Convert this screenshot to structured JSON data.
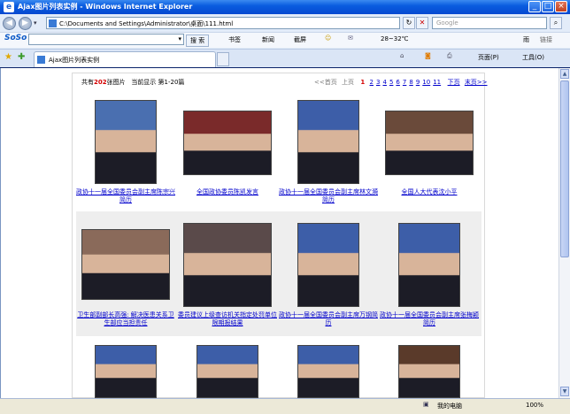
{
  "window": {
    "title": "Ajax图片列表实例 - Windows Internet Explorer",
    "icon": "ie-logo-icon"
  },
  "address": {
    "url": "C:\\Documents and Settings\\Administrator\\桌面\\111.html"
  },
  "search": {
    "placeholder": "Google"
  },
  "soso": {
    "logo": "SoSo",
    "search_button": "搜 索"
  },
  "toolbar": {
    "bookmarks": "书签",
    "news": "新闻",
    "screenshot": "截屏",
    "weather": "28~32℃",
    "weather_right": "雨",
    "links": "链接"
  },
  "tab": {
    "label": "Ajax图片列表实例"
  },
  "commandbar": {
    "page": "页面(P)",
    "tools": "工具(O)"
  },
  "content": {
    "info_prefix": "共有",
    "count": "202",
    "info_suffix": "张图片",
    "current": "当前显示 第1-20篇",
    "pager": {
      "first": "<<首页",
      "prev": "上页",
      "current": "1",
      "pages": [
        "2",
        "3",
        "4",
        "5",
        "6",
        "7",
        "8",
        "9",
        "10",
        "11"
      ],
      "next": "下页",
      "last": "末页>>"
    },
    "items": [
      {
        "caption": "政协十一届全国委员会副主席陈宗兴简历"
      },
      {
        "caption": "全国政协委员陈凯发言"
      },
      {
        "caption": "政协十一届全国委员会副主席林文漪简历"
      },
      {
        "caption": "全国人大代表沈小平"
      },
      {
        "caption": "卫生部副部长高强: 解决医患关系卫生部应当担责任"
      },
      {
        "caption": "委员建议上级查访机关指定处罚单位限期报结果"
      },
      {
        "caption": "政协十一届全国委员会副主席万钢简历"
      },
      {
        "caption": "政协十一届全国委员会副主席张梅颖简历"
      },
      {
        "caption": ""
      },
      {
        "caption": ""
      },
      {
        "caption": ""
      },
      {
        "caption": ""
      }
    ]
  },
  "status": {
    "computer": "我的电脑",
    "zoom": "100%"
  },
  "colors": {
    "link": "#0000cc",
    "count": "#d40000",
    "titlebar": "#0a5de0"
  }
}
